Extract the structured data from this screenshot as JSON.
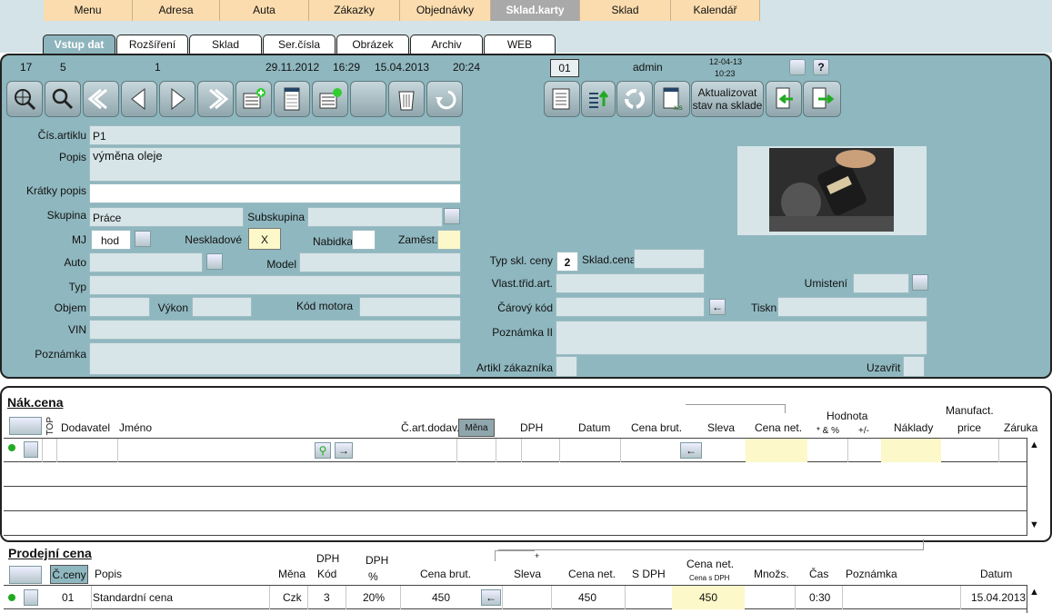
{
  "menu": [
    "Menu",
    "Adresa",
    "Auta",
    "Zákazky",
    "Objednávky",
    "Sklad.karty",
    "Sklad",
    "Kalendář"
  ],
  "subtabs": [
    "Vstup dat",
    "Rozšíření",
    "Sklad",
    "Ser.čísla",
    "Obrázek",
    "Archiv",
    "WEB"
  ],
  "status": {
    "n1": "17",
    "n2": "5",
    "n3": "1",
    "date1": "29.11.2012",
    "time1": "16:29",
    "date2": "15.04.2013",
    "time2": "20:24",
    "code": "01",
    "user": "admin",
    "stamp_date": "12-04-13",
    "stamp_time": "10:23"
  },
  "update_button": [
    "Aktualizovat",
    "stav na sklade"
  ],
  "form": {
    "cis_artiklu_label": "Čís.artiklu",
    "cis_artiklu": "P1",
    "popis_label": "Popis",
    "popis": "výměna oleje",
    "kratky_label": "Krátky popis",
    "skupina_label": "Skupina",
    "skupina": "Práce",
    "subskupina_label": "Subskupina",
    "mj_label": "MJ",
    "mj": "hod",
    "neskladove_label": "Neskladové",
    "neskladove": "X",
    "nabidka_label": "Nabidka",
    "zamest_label": "Zaměst.",
    "auto_label": "Auto",
    "model_label": "Model",
    "typ_label": "Typ",
    "objem_label": "Objem",
    "vykon_label": "Výkon",
    "kod_motora_label": "Kód motora",
    "vin_label": "VIN",
    "poznamka_label": "Poznámka",
    "typ_skl_label": "Typ skl. ceny",
    "typ_skl": "2",
    "skl_cena_label": "Sklad.cena",
    "vlast_label": "Vlast.třid.art.",
    "umisteni_label": "Umistení",
    "carovy_label": "Čárový kód",
    "tiskni_label": "Tiskni",
    "poznamka2_label": "Poznámka II",
    "artikl_zak_label": "Artikl zákazníka",
    "uzavrit_label": "Uzavřit"
  },
  "nak": {
    "title": "Nák.cena",
    "headers": {
      "top": "TOP",
      "dodavatel": "Dodavatel",
      "jmeno": "Jméno",
      "cart": "Č.art.dodav.",
      "mena": "Měna",
      "dph": "DPH",
      "datum": "Datum",
      "cena_brut": "Cena brut.",
      "sleva": "Sleva",
      "cena_net": "Cena net.",
      "hodnota": "Hodnota",
      "pct": "* & %",
      "pm": "+/-",
      "naklady": "Náklady",
      "manufact": "Manufact.",
      "price": "price",
      "zaruka": "Záruka"
    }
  },
  "prod": {
    "title": "Prodejní cena",
    "headers": {
      "ceny": "Č.ceny",
      "popis": "Popis",
      "mena": "Měna",
      "dph": "DPH",
      "kod": "Kód",
      "dph2": "DPH",
      "pct": "%",
      "cena_brut": "Cena brut.",
      "sleva": "Sleva",
      "cena_net": "Cena net.",
      "sdph": "S DPH",
      "cena_net2": "Cena net.",
      "cena_sdph": "Cena s DPH",
      "mnozs": "Množs.",
      "cas": "Čas",
      "poznamka": "Poznámka",
      "datum": "Datum",
      "plus": "+"
    },
    "row": {
      "c": "01",
      "popis": "Standardní cena",
      "mena": "Czk",
      "kod": "3",
      "dph": "20%",
      "cena_brut": "450",
      "cena_net": "450",
      "cena_net2": "450",
      "cas": "0:30",
      "datum": "15.04.2013"
    }
  }
}
